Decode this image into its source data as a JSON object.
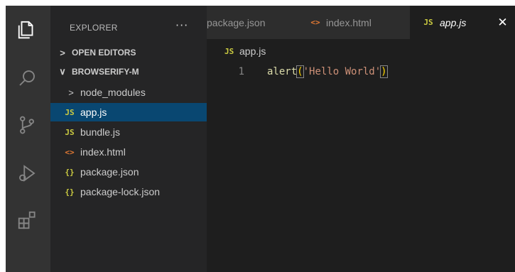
{
  "window": {
    "accent": "#094771"
  },
  "activity_bar": {
    "icons": [
      "explorer-icon",
      "search-icon",
      "source-control-icon",
      "run-debug-icon",
      "extensions-icon"
    ]
  },
  "sidebar": {
    "title": "EXPLORER",
    "more": "···",
    "sections": {
      "open_editors": "OPEN EDITORS",
      "project": "BROWSERIFY-M"
    },
    "items": [
      {
        "label": "node_modules",
        "type": "folder"
      },
      {
        "label": "app.js",
        "type": "js",
        "icon_text": "JS"
      },
      {
        "label": "bundle.js",
        "type": "js",
        "icon_text": "JS"
      },
      {
        "label": "index.html",
        "type": "html",
        "icon_text": "<>"
      },
      {
        "label": "package.json",
        "type": "json",
        "icon_text": "{}"
      },
      {
        "label": "package-lock.json",
        "type": "json",
        "icon_text": "{}"
      }
    ]
  },
  "tabs": [
    {
      "label": "package.json"
    },
    {
      "label": "index.html",
      "icon_text": "<>"
    },
    {
      "label": "app.js",
      "icon_text": "JS",
      "active": true,
      "close": "✕"
    }
  ],
  "breadcrumb": {
    "icon_text": "JS",
    "label": "app.js"
  },
  "editor": {
    "lines": [
      {
        "number": "1",
        "fn": "alert",
        "open": "(",
        "string": "'Hello World'",
        "close": ")"
      }
    ]
  }
}
